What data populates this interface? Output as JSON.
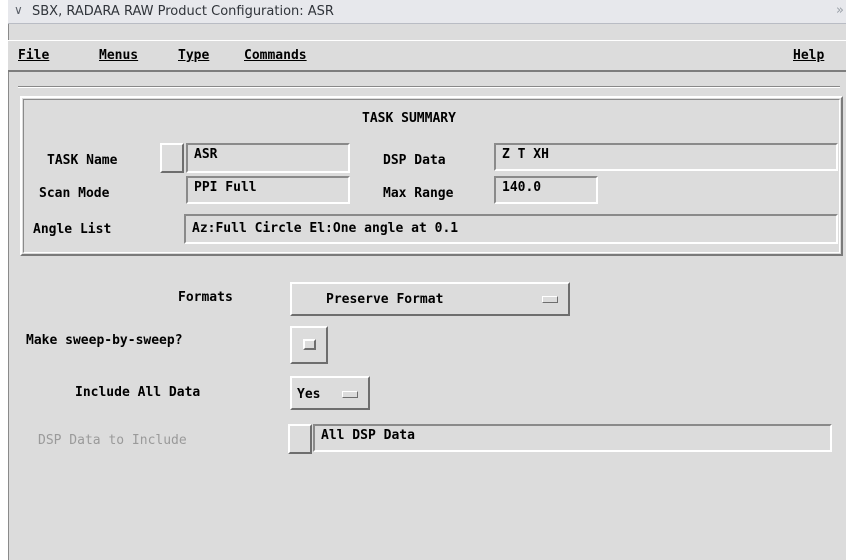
{
  "window": {
    "title": "SBX, RADARA  RAW Product Configuration: ASR",
    "icons": [
      "chevron-down-icon",
      "close-icon"
    ]
  },
  "menubar": {
    "file": "File",
    "menus": "Menus",
    "type": "Type",
    "commands": "Commands",
    "help": "Help"
  },
  "summary": {
    "heading": "TASK SUMMARY",
    "task_name_label": "TASK Name",
    "task_name_value": "ASR",
    "scan_mode_label": "Scan Mode",
    "scan_mode_value": "PPI Full",
    "angle_list_label": "Angle List",
    "angle_list_value": "Az:Full Circle    El:One angle at 0.1",
    "dsp_data_label": "DSP Data",
    "dsp_data_value": "Z T XH",
    "max_range_label": "Max Range",
    "max_range_value": "140.0"
  },
  "form": {
    "formats_label": "Formats",
    "formats_value": "Preserve Format",
    "sweep_label": "Make sweep-by-sweep?",
    "sweep_checked": false,
    "include_all_label": "Include All Data",
    "include_all_value": "Yes",
    "dsp_include_label": "DSP Data to Include",
    "dsp_include_value": "All DSP Data"
  },
  "colors": {
    "background": "#dcdcdc",
    "titlebar": "#e7e8ec",
    "disabled_text": "#9a9a9a"
  }
}
